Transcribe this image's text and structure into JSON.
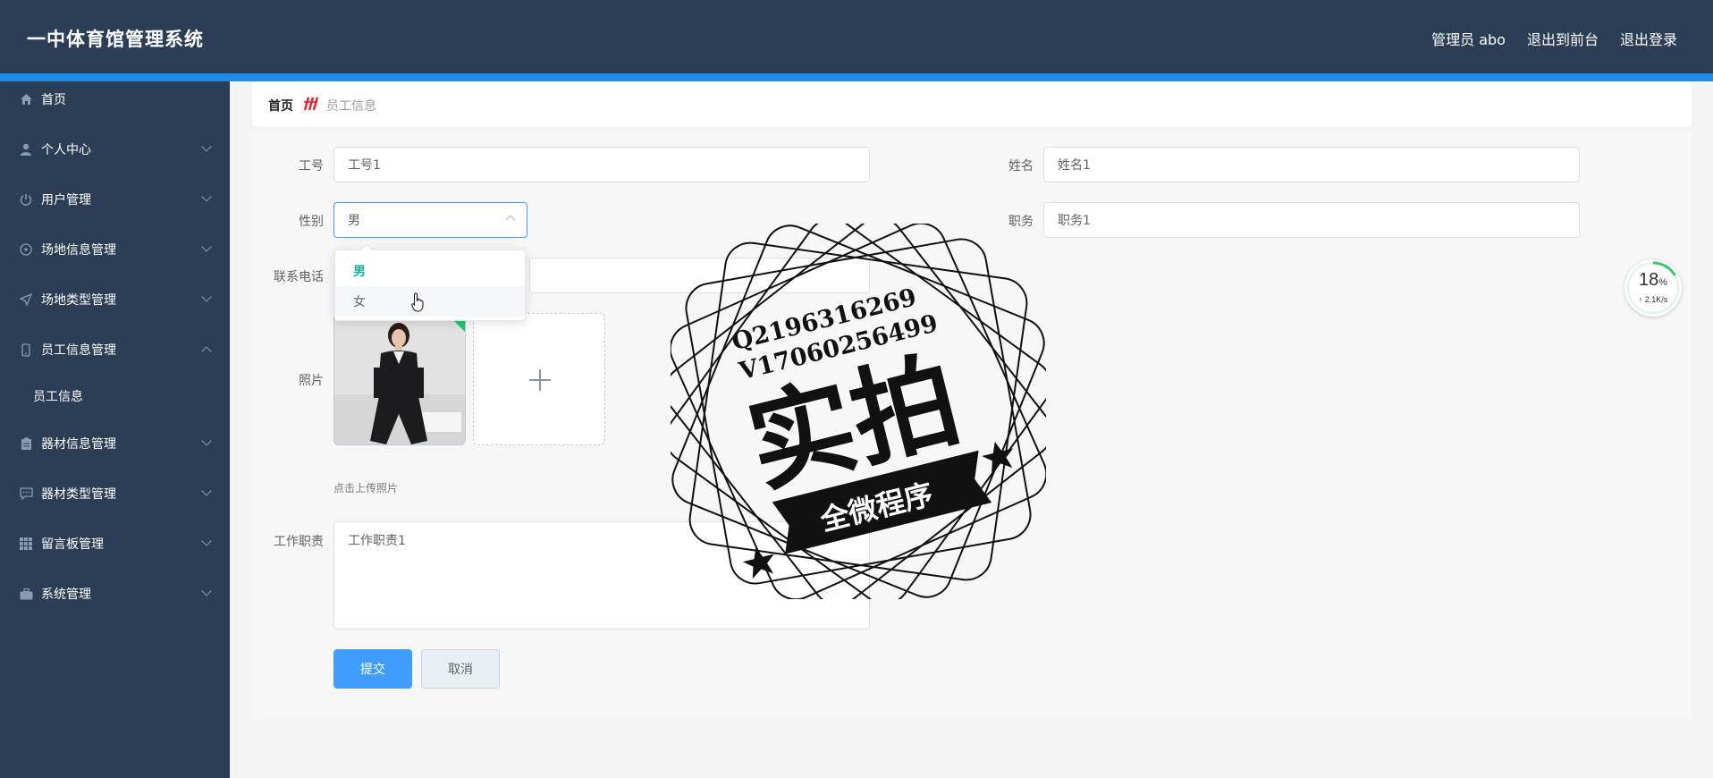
{
  "header": {
    "brand": "一中体育馆管理系统",
    "admin": "管理员 abo",
    "to_front": "退出到前台",
    "logout": "退出登录"
  },
  "sidebar": {
    "items": [
      {
        "label": "首页",
        "icon": "home-icon"
      },
      {
        "label": "个人中心",
        "icon": "user-icon"
      },
      {
        "label": "用户管理",
        "icon": "power-icon"
      },
      {
        "label": "场地信息管理",
        "icon": "compass-icon"
      },
      {
        "label": "场地类型管理",
        "icon": "send-icon"
      },
      {
        "label": "员工信息管理",
        "icon": "mobile-icon"
      },
      {
        "label": "员工信息",
        "icon": ""
      },
      {
        "label": "器材信息管理",
        "icon": "clipboard-icon"
      },
      {
        "label": "器材类型管理",
        "icon": "message-icon"
      },
      {
        "label": "留言板管理",
        "icon": "grid-icon"
      },
      {
        "label": "系统管理",
        "icon": "briefcase-icon"
      }
    ]
  },
  "breadcrumb": {
    "home": "首页",
    "current": "员工信息"
  },
  "form": {
    "gonghao_label": "工号",
    "gonghao_value": "工号1",
    "xingming_label": "姓名",
    "xingming_value": "姓名1",
    "xingbie_label": "性别",
    "xingbie_value": "男",
    "zhiwu_label": "职务",
    "zhiwu_value": "职务1",
    "phone_label": "联系电话",
    "photo_label": "照片",
    "upload_hint": "点击上传照片",
    "duty_label": "工作职责",
    "duty_value": "工作职责1",
    "submit": "提交",
    "cancel": "取消"
  },
  "dropdown": {
    "options": [
      "男",
      "女"
    ],
    "selected": "男"
  },
  "watermark": {
    "line1": "Q2196316269",
    "line2": "V17060256499",
    "big": "实拍",
    "banner": "全微程序"
  },
  "gauge": {
    "percent": "18",
    "unit": "%",
    "rate": "↑ 2.1K/s"
  },
  "colors": {
    "sidebar_bg": "#2c3e55",
    "accent": "#409eff",
    "top_line": "#1f8ceb",
    "selected_option": "#13b59a"
  }
}
